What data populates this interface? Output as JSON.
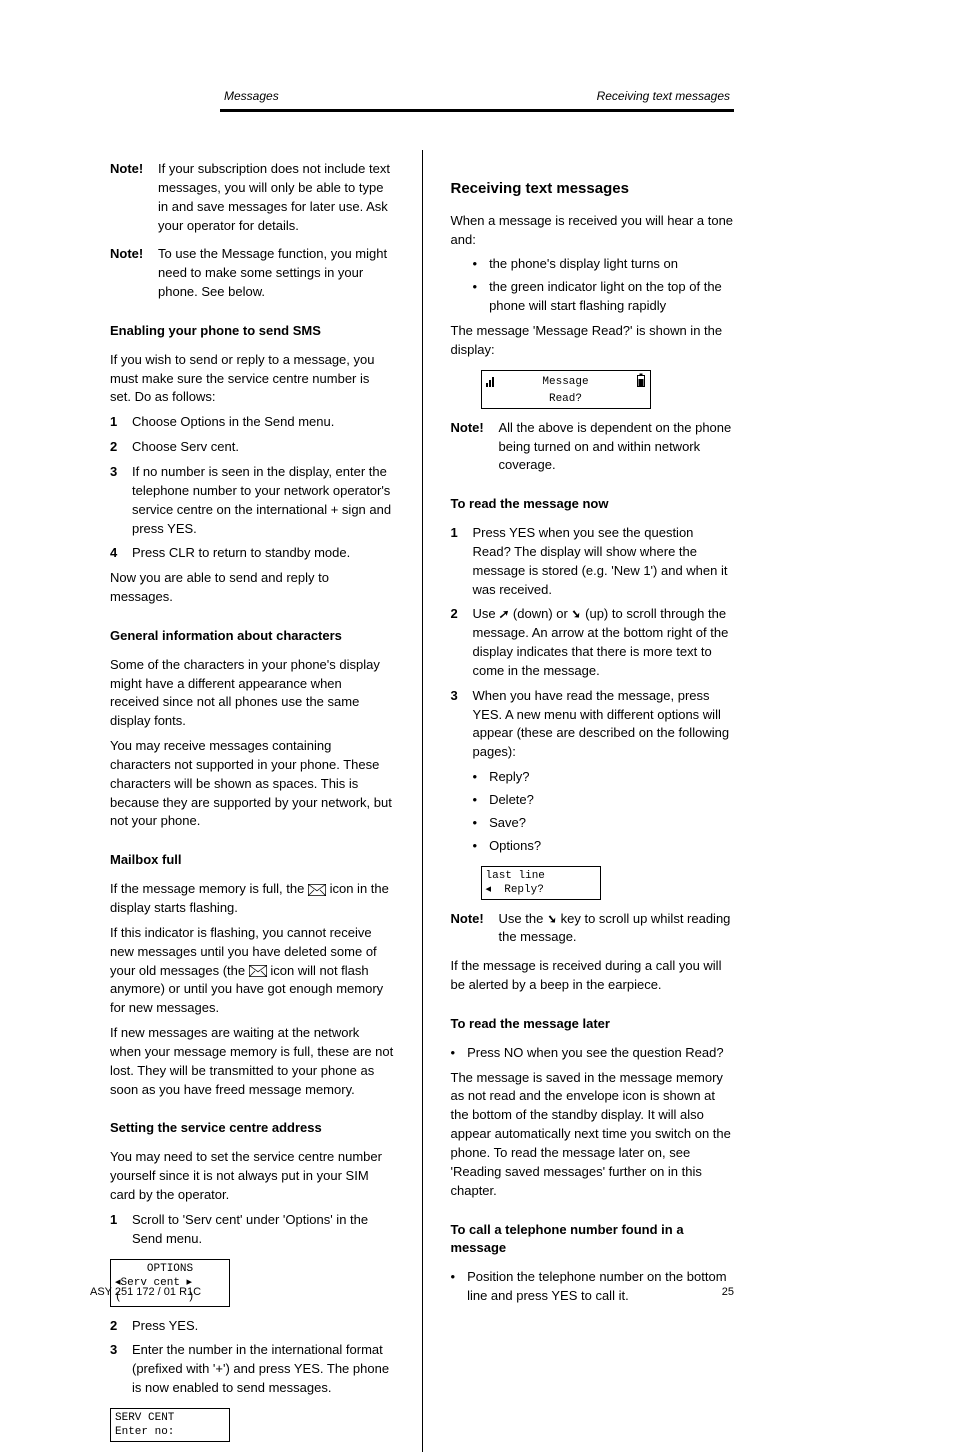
{
  "header": {
    "subject_left": "Messages",
    "subject_right": "Receiving text messages"
  },
  "left_col": {
    "note1_label": "Note!",
    "note1_text": "If your subscription does not include text messages, you will only be able to type in and save messages for later use. Ask your operator for details.",
    "note2_label": "Note!",
    "note2_text": "To use the Message function, you might need to make some settings in your phone. See below.",
    "h_enable": "Enabling your phone to send SMS",
    "p_enable": "If you wish to send or reply to a message, you must make sure the service centre number is set. Do as follows:",
    "enable_steps": [
      "Choose Options in the Send menu.",
      "Choose Serv cent.",
      "If no number is seen in the display, enter the telephone number to your network operator's service centre on the international + sign and press YES.",
      "Press CLR to return to standby mode."
    ],
    "p_now": "Now you are able to send and reply to messages.",
    "h_general": "General information about characters",
    "p_general1": "Some of the characters in your phone's display might have a different appearance when received since not all phones use the same display fonts.",
    "p_general2": "You may receive messages containing characters not supported in your phone. These characters will be shown as spaces. This is because they are supported by your network, but not your phone.",
    "h_mail": "Mailbox full",
    "p_mail1": "If the message memory is full, the ",
    "p_mail1b": " icon in the display starts flashing.",
    "p_mail2": "If this indicator is flashing, you cannot receive new messages until you have deleted some of your old messages (the  ",
    "p_mail2b": " icon will not flash anymore) or until you have got enough memory for new messages.",
    "p_mail3": "If new messages are waiting at the network when your message memory is full, these are not lost. They will be transmitted to your phone as soon as you have freed message memory.",
    "h_srvcent": "Setting the service centre address",
    "p_srvcent": "You may need to set the service centre number yourself since it is not always put in your SIM card by the operator.",
    "srvcent_steps": [
      "Scroll to 'Serv cent' under 'Options' in the Send menu.",
      "Press YES.",
      "Enter the number in the international format (prefixed with '+') and press YES.\nThe phone is now enabled to send messages."
    ],
    "lcd_options": {
      "l1": "OPTIONS",
      "l2": "◂Serv cent ▸",
      "l3": "(          )"
    },
    "lcd_servcent": {
      "l1": "SERV CENT",
      "l2": "Enter no:"
    }
  },
  "right_col": {
    "h_receiving": "Receiving text messages",
    "p_recv1": "When a message is received you will hear a tone and:",
    "bullet1": "the phone's display light turns on",
    "bullet2": "the green indicator light on the top of the phone will start flashing rapidly",
    "p_recv2": "The message 'Message Read?' is shown in the display:",
    "lcd_msg": {
      "l1": "Message",
      "l2": "Read?"
    },
    "note1_label": "Note!",
    "note1_text": "All the above is dependent on the phone being turned on and within network coverage.",
    "h_readnow": "To read the message now",
    "readnow_steps": [
      {
        "n": "1",
        "t": "Press YES when you see the question Read?\nThe display will show where the message is stored (e.g. 'New 1') and when it was received."
      },
      {
        "n": "2",
        "t": "Use ",
        "t_end": " (down) or ",
        "t_end2": " (up) to scroll through the message.\nAn arrow at the bottom right of the display indicates that there is more text to come in the message."
      },
      {
        "n": "3",
        "t": "When you have read the message, press YES.\nA new menu with different options will appear (these are described on the following pages):"
      }
    ],
    "options_list": [
      "Reply?",
      "Delete?",
      "Save?",
      "Options?"
    ],
    "lcd_lastline": {
      "l1": "last line",
      "l2": "◂  Reply?"
    },
    "note2_label": "Note!",
    "note2_text": "Use the ",
    "note2_text2": " key to scroll up whilst reading the message.",
    "p_end": "If the message is received during a call you will be alerted by a beep in the earpiece.",
    "h_readlater": "To read the message later",
    "p_later1": "Press NO when you see the question Read?",
    "p_later2": "The message is saved in the message memory as not read and the envelope icon is shown at the bottom of the standby display. It will also appear automatically next time you switch on the phone. To read the message later on, see 'Reading saved messages' further on in this chapter.",
    "h_call": "To call a telephone number found in a message",
    "call_steps": [
      "Position the telephone number on the bottom line and press YES to call it."
    ]
  },
  "footer": {
    "doc": "ASY 251 172 / 01 R1C",
    "page": "25"
  }
}
